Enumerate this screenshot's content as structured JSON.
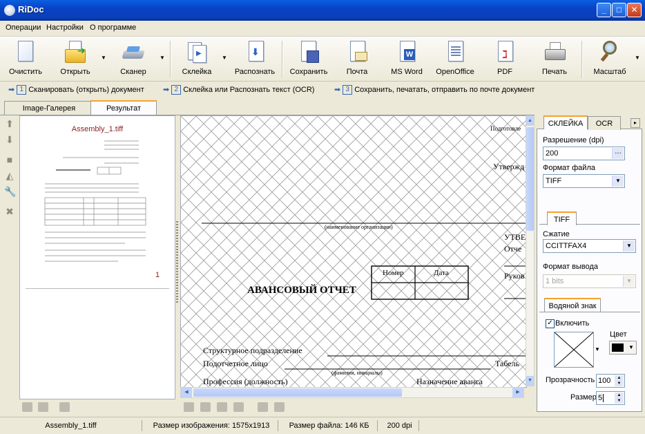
{
  "window": {
    "title": "RiDoc"
  },
  "menu": [
    "Операции",
    "Настройки",
    "О программе"
  ],
  "toolbar": {
    "clear": "Очистить",
    "open": "Открыть",
    "scanner": "Сканер",
    "glue": "Склейка",
    "recognize": "Распознать",
    "save": "Сохранить",
    "mail": "Почта",
    "msword": "MS Word",
    "openoffice": "OpenOffice",
    "pdf": "PDF",
    "print": "Печать",
    "zoom": "Масштаб"
  },
  "steps": [
    {
      "num": "1",
      "text": "Сканировать (открыть) документ"
    },
    {
      "num": "2",
      "text": "Склейка или Распознать текст (OCR)"
    },
    {
      "num": "3",
      "text": "Сохранить, печатать, отправить по почте документ"
    }
  ],
  "tabs": {
    "gallery": "Image-Галерея",
    "result": "Результат"
  },
  "gallery": {
    "filename": "Assembly_1.tiff",
    "page_number": "1"
  },
  "document": {
    "top_right_1": "Подготовле",
    "top_right_2": "Утвержд",
    "org_caption": "(наименование организации)",
    "utv": "УТВЕ",
    "otch": "Отче",
    "ruk": "Руков",
    "col_number": "Номер",
    "col_date": "Дата",
    "heading": "АВАНСОВЫЙ ОТЧЕТ",
    "struct": "Структурное подразделение",
    "podot": "Подотчетное лицо",
    "tabel": "Табель",
    "fio_caption": "(фамилия, инициалы)",
    "profession": "Профессия (должность)",
    "purpose": "Назначение аванса"
  },
  "right_tabs": {
    "glue": "СКЛЕЙКА",
    "ocr": "OCR"
  },
  "settings": {
    "resolution_label": "Разрешение (dpi)",
    "resolution_value": "200",
    "format_label": "Формат файла",
    "format_value": "TIFF",
    "tiff_tab": "TIFF",
    "compression_label": "Сжатие",
    "compression_value": "CCITTFAX4",
    "output_label": "Формат вывода",
    "output_value": "1 bits",
    "watermark_tab": "Водяной знак",
    "enable_label": "Включить",
    "enable_checked": true,
    "color_label": "Цвет",
    "transparency_label": "Прозрачность",
    "transparency_value": "100",
    "size_label": "Размер",
    "size_value": "5"
  },
  "status": {
    "file": "Assembly_1.tiff",
    "image_size": "Размер изображения: 1575x1913",
    "file_size": "Размер файла: 146 КБ",
    "dpi": "200 dpi"
  }
}
